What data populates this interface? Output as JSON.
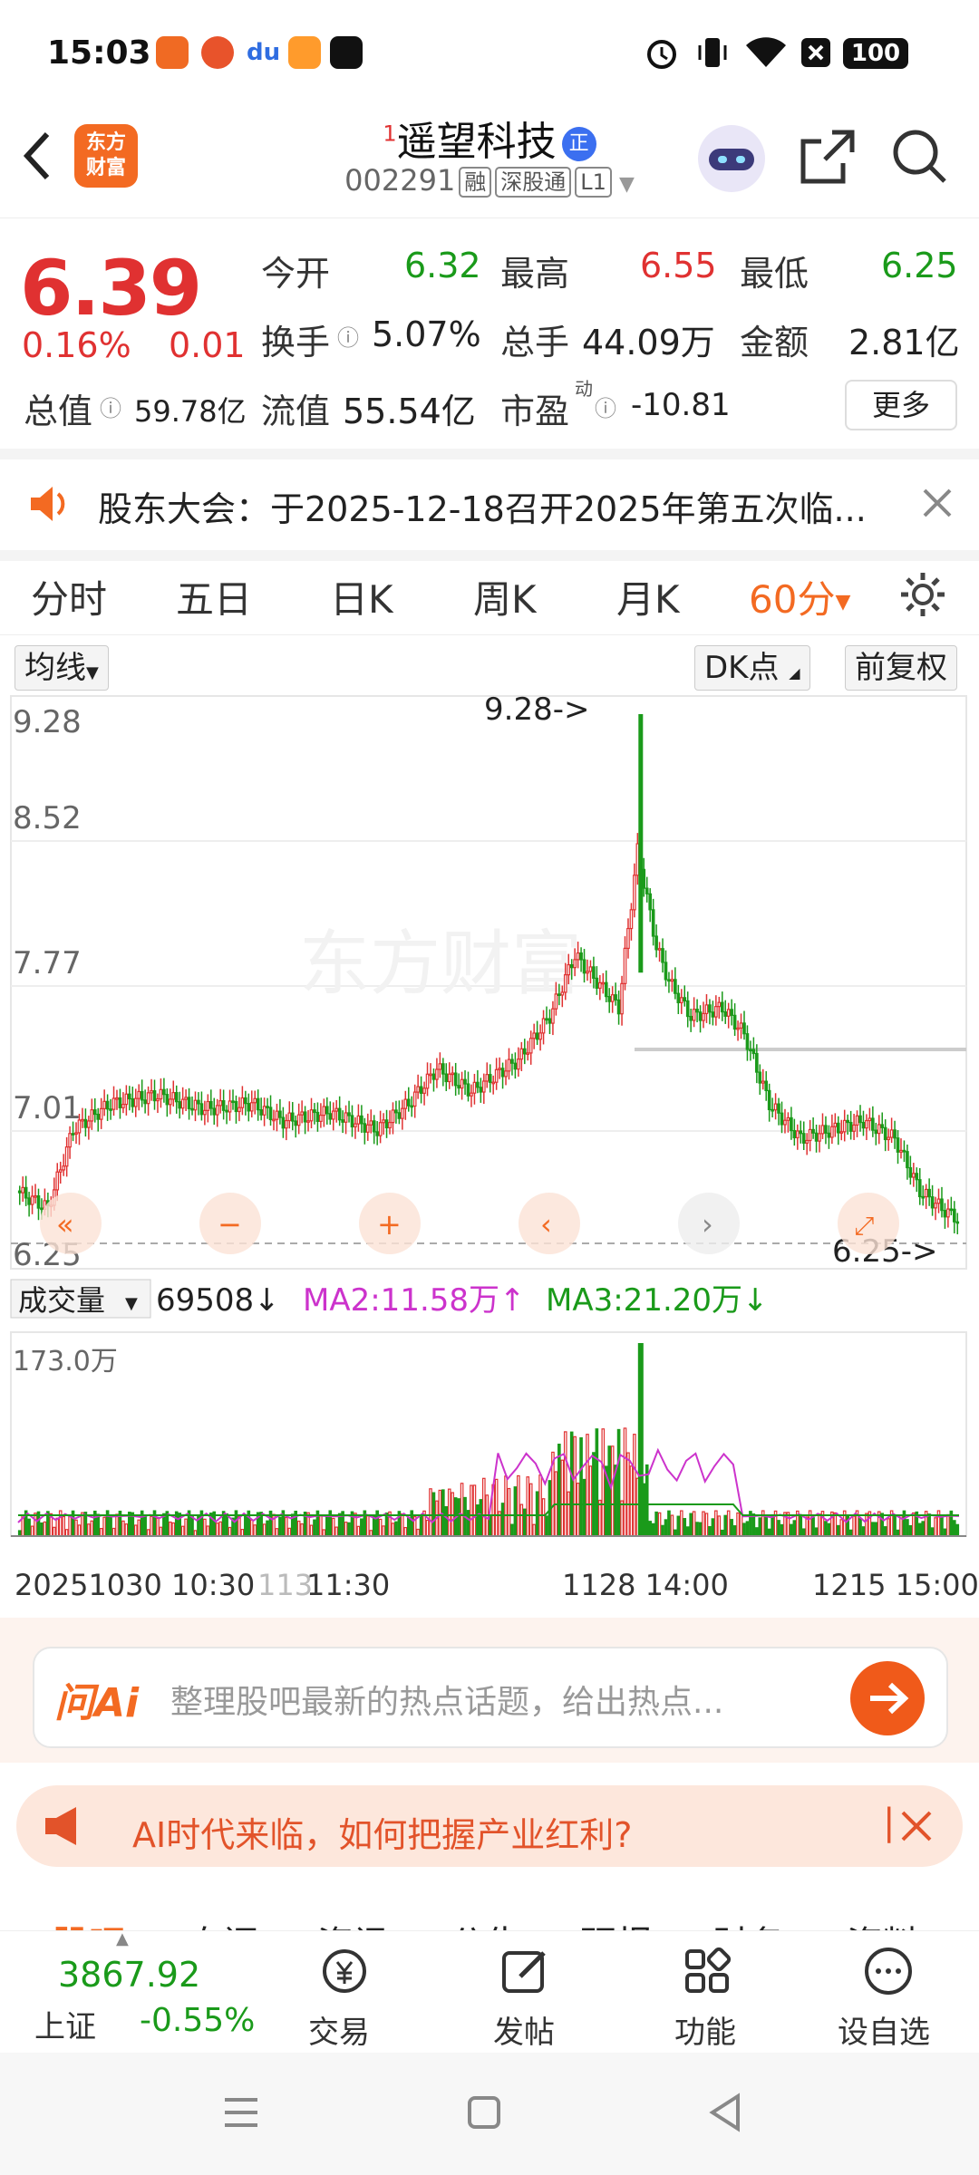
{
  "status_bar": {
    "time": "15:03",
    "battery": "100"
  },
  "header": {
    "back_icon": "chevron-left-icon",
    "logo_line1": "东方",
    "logo_line2": "财富",
    "superscript": "1",
    "stock_name": "遥望科技",
    "badge": "正",
    "stock_code": "002291",
    "tags": [
      "融",
      "深股通",
      "L1"
    ]
  },
  "quote": {
    "price": "6.39",
    "change_pct": "0.16%",
    "change_amt": "0.01",
    "open_label": "今开",
    "open": "6.32",
    "high_label": "最高",
    "high": "6.55",
    "low_label": "最低",
    "low": "6.25",
    "turnover_label": "换手",
    "turnover": "5.07%",
    "volume_label": "总手",
    "volume": "44.09万",
    "amount_label": "金额",
    "amount": "2.81亿",
    "mktcap_label": "总值",
    "mktcap": "59.78亿",
    "float_label": "流值",
    "float": "55.54亿",
    "pe_label": "市盈",
    "pe_sup": "动",
    "pe": "-10.81",
    "more": "更多"
  },
  "notice": {
    "text": "股东大会：于2025-12-18召开2025年第五次临..."
  },
  "tabs": [
    "分时",
    "五日",
    "日K",
    "周K",
    "月K",
    "60分"
  ],
  "active_tab": 5,
  "chart_controls": {
    "ma_button": "均线",
    "dk_button": "DK点",
    "adjust_button": "前复权",
    "watermark": "东方财富"
  },
  "chart_data": {
    "type": "candlestick",
    "y_ticks": [
      "9.28",
      "8.52",
      "7.77",
      "7.01",
      "6.25"
    ],
    "ylim": [
      6.25,
      9.28
    ],
    "max_label": "9.28->",
    "min_label": "6.25->",
    "volume_header": "成交量",
    "volume_value": "69508",
    "ma2_label": "MA2:11.58万",
    "ma3_label": "MA3:21.20万",
    "volume_max_label": "173.0万",
    "x_labels": [
      "20251030 10:30",
      "113",
      "11:30",
      "1128 14:00",
      "1215 15:00"
    ]
  },
  "colors": {
    "up": "#e03131",
    "down": "#1a9a1a",
    "accent": "#f36a22",
    "ma2": "#cc33cc",
    "ma3": "#1a9a1a"
  },
  "ai_bar": {
    "logo": "问Ai",
    "placeholder": "整理股吧最新的热点话题，给出热点..."
  },
  "promo": {
    "text": "AI时代来临，如何把握产业红利?"
  },
  "sub_tabs": [
    "股吧",
    "自问",
    "资讯",
    "公告",
    "研报",
    "财务",
    "资料"
  ],
  "bottom_nav": {
    "index_value": "3867.92",
    "index_name": "上证",
    "index_change": "-0.55%",
    "items": [
      "交易",
      "发帖",
      "功能",
      "设自选"
    ]
  }
}
